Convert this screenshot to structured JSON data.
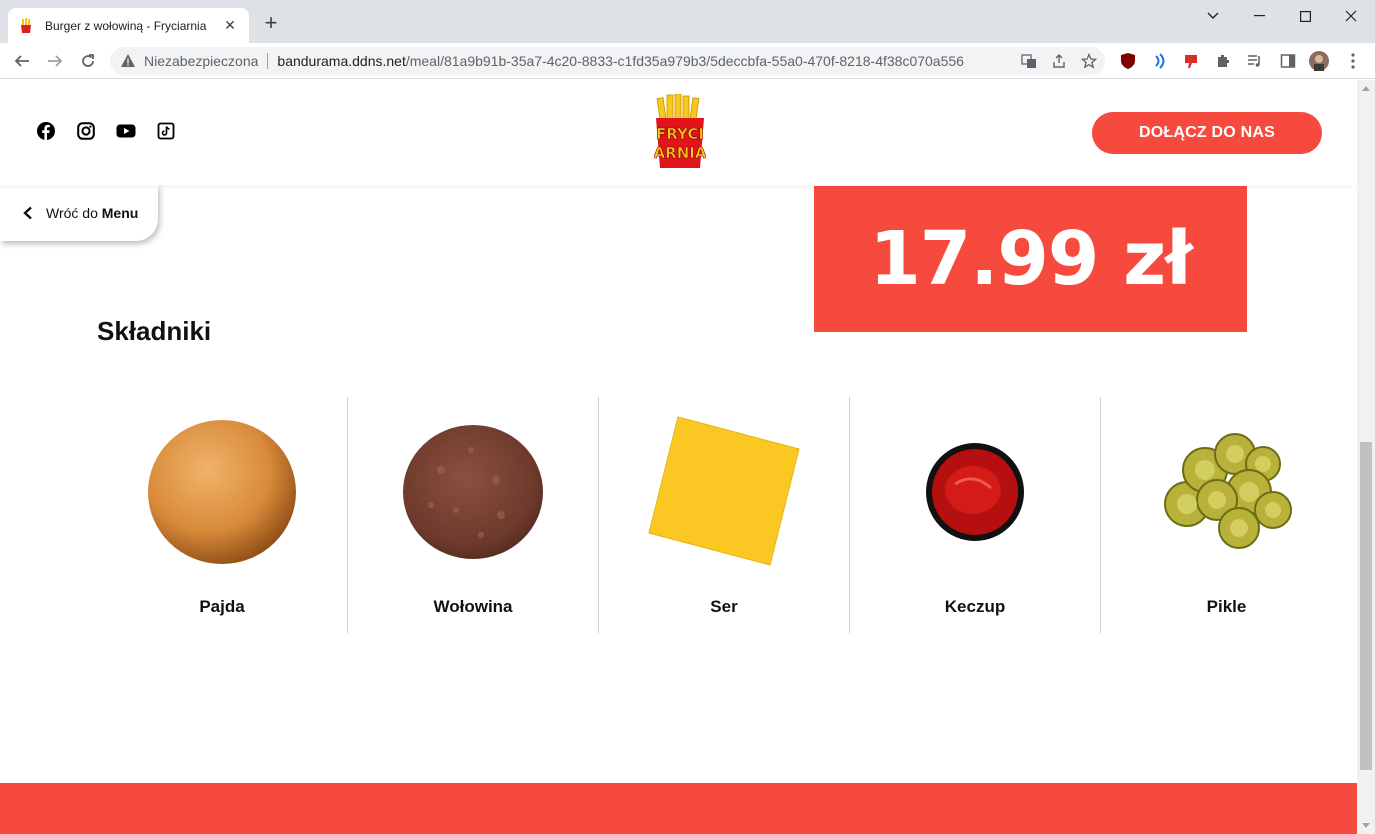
{
  "browser": {
    "tab_title": "Burger z wołowiną - Fryciarnia",
    "security_label": "Niezabezpieczona",
    "url_host": "bandurama.ddns.net",
    "url_path": "/meal/81a9b91b-35a7-4c20-8833-c1fd35a979b3/5deccbfa-55a0-470f-8218-4f38c070a556"
  },
  "header": {
    "social_icons": [
      "facebook-icon",
      "instagram-icon",
      "youtube-icon",
      "tiktok-icon"
    ],
    "logo_text_top": "FRYCI",
    "logo_text_bottom": "ARNIA",
    "join_label": "DOŁĄCZ DO NAS"
  },
  "back": {
    "prefix": "Wróć do",
    "bold": "Menu"
  },
  "price": "17.99 zł",
  "ingredients_title": "Składniki",
  "ingredients": [
    {
      "name": "Pajda",
      "icon": "bun-icon"
    },
    {
      "name": "Wołowina",
      "icon": "beef-patty-icon"
    },
    {
      "name": "Ser",
      "icon": "cheese-icon"
    },
    {
      "name": "Keczup",
      "icon": "ketchup-icon"
    },
    {
      "name": "Pikle",
      "icon": "pickles-icon"
    }
  ],
  "colors": {
    "accent": "#f74a3f",
    "tab_bar": "#dee1e6"
  }
}
